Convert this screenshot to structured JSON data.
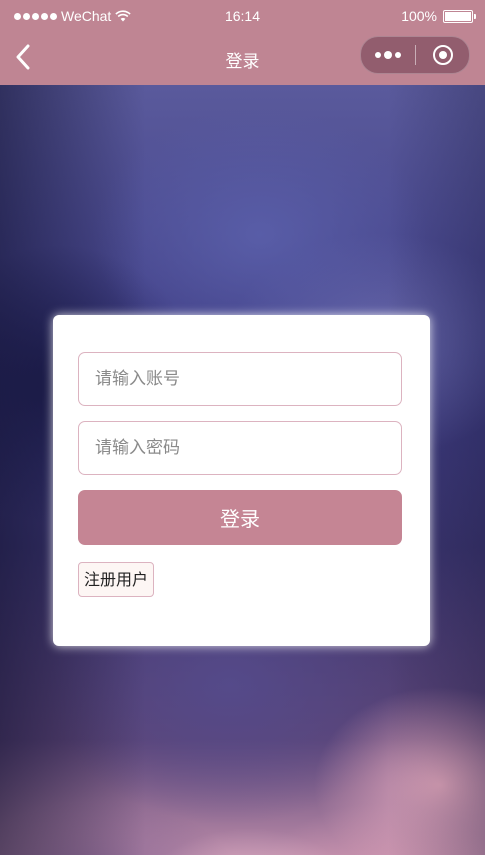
{
  "status_bar": {
    "carrier": "WeChat",
    "time": "16:14",
    "battery": "100%",
    "battery_level": 1.0
  },
  "nav_bar": {
    "title": "登录",
    "back_icon": "chevron-left-icon",
    "more_icon": "more-dots-icon",
    "close_icon": "target-circle-icon"
  },
  "login_form": {
    "account_placeholder": "请输入账号",
    "password_placeholder": "请输入密码",
    "login_label": "登录",
    "register_label": "注册用户"
  },
  "colors": {
    "brand": "#bf8593",
    "button": "#c58594",
    "input_border": "#dcb3c0"
  }
}
